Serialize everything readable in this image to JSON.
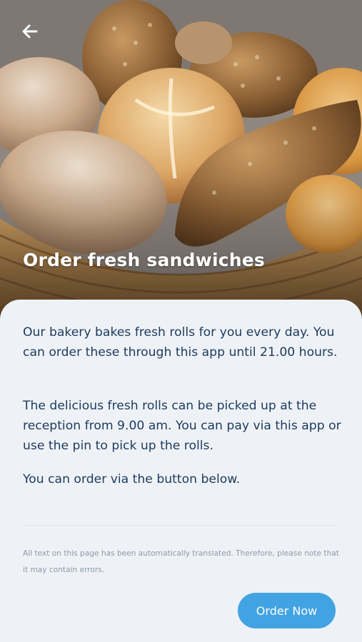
{
  "header": {
    "back_icon": "arrow-left-icon",
    "title": "Order fresh sandwiches"
  },
  "hero_image": {
    "subject": "basket of fresh bread rolls",
    "icon": "bread-rolls-photo"
  },
  "content": {
    "paragraphs": [
      "Our bakery bakes fresh rolls for you every day. You can order these through this app until 21.00 hours.",
      "The delicious fresh rolls can be picked up at the reception from 9.00 am. You can pay via this app or use the pin to pick up the rolls.",
      "You can order via the button below."
    ],
    "translation_note": "All text on this page has been automatically translated. Therefore, please note that it may contain errors."
  },
  "actions": {
    "order_label": "Order Now"
  },
  "colors": {
    "accent": "#42a3e3",
    "text": "#1d3a5c",
    "background": "#eef2f7",
    "muted": "#8e98a6"
  }
}
